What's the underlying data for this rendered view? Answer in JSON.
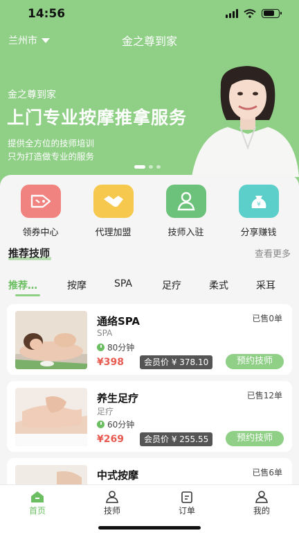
{
  "status_bar": {
    "time": "14:56"
  },
  "header": {
    "city": "兰州市",
    "app_title": "金之尊到家"
  },
  "banner": {
    "brand": "金之尊到家",
    "headline": "上门专业按摩推拿服务",
    "subtitle_1": "提供全方位的技师培训",
    "subtitle_2": "只为打造做专业的服务",
    "active_slide": 1,
    "slide_count": 3
  },
  "quick_actions": [
    {
      "label": "领券中心",
      "icon": "coupon-tag-icon",
      "color": "#f0837f"
    },
    {
      "label": "代理加盟",
      "icon": "handshake-icon",
      "color": "#f6c94e"
    },
    {
      "label": "技师入驻",
      "icon": "technician-badge-icon",
      "color": "#6cc27a"
    },
    {
      "label": "分享赚钱",
      "icon": "money-bag-icon",
      "color": "#5ccfcb"
    }
  ],
  "recommend": {
    "title": "推荐技师",
    "more": "查看更多"
  },
  "tabs": [
    "推荐…",
    "按摩",
    "SPA",
    "足疗",
    "柔式",
    "采耳"
  ],
  "services": [
    {
      "name": "通络SPA",
      "category": "SPA",
      "duration": "80分钟",
      "price": "¥398",
      "member_price": "会员价 ¥ 378.10",
      "sold": "已售0单",
      "book": "预约技师"
    },
    {
      "name": "养生足疗",
      "category": "足疗",
      "duration": "60分钟",
      "price": "¥269",
      "member_price": "会员价 ¥ 255.55",
      "sold": "已售12单",
      "book": "预约技师"
    },
    {
      "name": "中式按摩",
      "sold": "已售6单"
    }
  ],
  "bottom_nav": [
    {
      "label": "首页",
      "icon": "home-icon",
      "active": true
    },
    {
      "label": "技师",
      "icon": "technician-icon"
    },
    {
      "label": "订单",
      "icon": "order-icon"
    },
    {
      "label": "我的",
      "icon": "profile-icon"
    }
  ],
  "colors": {
    "brand_green": "#8fcf86",
    "accent_green": "#6bbf62",
    "price_red": "#e85a50"
  }
}
